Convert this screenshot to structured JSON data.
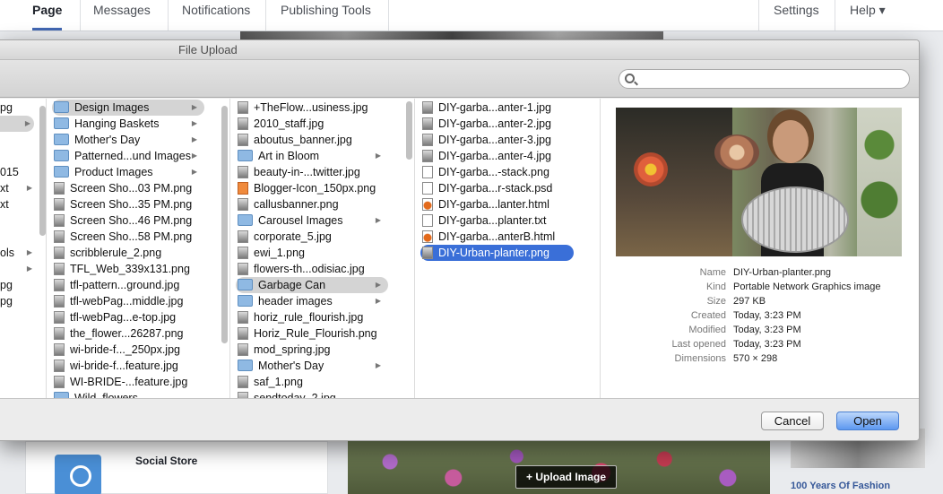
{
  "fb": {
    "tabs": [
      "Page",
      "Messages",
      "Notifications",
      "Publishing Tools",
      "Settings",
      "Help ▾"
    ],
    "left_card_label": "Social Store",
    "upload_button": "+ Upload Image",
    "right_caption": "100 Years Of Fashion"
  },
  "dialog": {
    "title": "File Upload",
    "search_placeholder": "",
    "col0": [
      "pg",
      "",
      "",
      "",
      "015",
      "xt",
      "xt",
      "",
      "",
      "ols",
      "",
      "pg",
      "pg"
    ],
    "col1": [
      {
        "label": "Design Images",
        "type": "folder",
        "selected": "grey",
        "chev": true
      },
      {
        "label": "Hanging Baskets",
        "type": "folder",
        "chev": true
      },
      {
        "label": "Mother's Day",
        "type": "folder",
        "chev": true
      },
      {
        "label": "Patterned...und Images",
        "type": "folder",
        "chev": true
      },
      {
        "label": "Product Images",
        "type": "folder",
        "chev": true
      },
      {
        "label": "Screen Sho...03 PM.png",
        "type": "img"
      },
      {
        "label": "Screen Sho...35 PM.png",
        "type": "img"
      },
      {
        "label": "Screen Sho...46 PM.png",
        "type": "img"
      },
      {
        "label": "Screen Sho...58 PM.png",
        "type": "img"
      },
      {
        "label": "scribblerule_2.png",
        "type": "img"
      },
      {
        "label": "TFL_Web_339x131.png",
        "type": "img"
      },
      {
        "label": "tfl-pattern...ground.jpg",
        "type": "img"
      },
      {
        "label": "tfl-webPag...middle.jpg",
        "type": "img"
      },
      {
        "label": "tfl-webPag...e-top.jpg",
        "type": "img"
      },
      {
        "label": "the_flower...26287.png",
        "type": "img"
      },
      {
        "label": "wi-bride-f..._250px.jpg",
        "type": "img"
      },
      {
        "label": "wi-bride-f...feature.jpg",
        "type": "img"
      },
      {
        "label": "WI-BRIDE-...feature.jpg",
        "type": "img"
      },
      {
        "label": "Wild_flowers",
        "type": "folder"
      }
    ],
    "col2": [
      {
        "label": "+TheFlow...usiness.jpg",
        "type": "img"
      },
      {
        "label": "2010_staff.jpg",
        "type": "img"
      },
      {
        "label": "aboutus_banner.jpg",
        "type": "img"
      },
      {
        "label": "Art in Bloom",
        "type": "folder",
        "chev": true
      },
      {
        "label": "beauty-in-...twitter.jpg",
        "type": "img"
      },
      {
        "label": "Blogger-Icon_150px.png",
        "type": "orange"
      },
      {
        "label": "callusbanner.png",
        "type": "img"
      },
      {
        "label": "Carousel Images",
        "type": "folder",
        "chev": true
      },
      {
        "label": "corporate_5.jpg",
        "type": "img"
      },
      {
        "label": "ewi_1.png",
        "type": "img"
      },
      {
        "label": "flowers-th...odisiac.jpg",
        "type": "img"
      },
      {
        "label": "Garbage Can",
        "type": "folder",
        "selected": "grey",
        "chev": true
      },
      {
        "label": "header images",
        "type": "folder",
        "chev": true
      },
      {
        "label": "horiz_rule_flourish.jpg",
        "type": "img"
      },
      {
        "label": "Horiz_Rule_Flourish.png",
        "type": "img"
      },
      {
        "label": "mod_spring.jpg",
        "type": "img"
      },
      {
        "label": "Mother's Day",
        "type": "folder",
        "chev": true
      },
      {
        "label": "saf_1.png",
        "type": "img"
      },
      {
        "label": "sendtoday_2.jpg",
        "type": "img"
      }
    ],
    "col3": [
      {
        "label": "DIY-garba...anter-1.jpg",
        "type": "img"
      },
      {
        "label": "DIY-garba...anter-2.jpg",
        "type": "img"
      },
      {
        "label": "DIY-garba...anter-3.jpg",
        "type": "img"
      },
      {
        "label": "DIY-garba...anter-4.jpg",
        "type": "img"
      },
      {
        "label": "DIY-garba...-stack.png",
        "type": "file"
      },
      {
        "label": "DIY-garba...r-stack.psd",
        "type": "file"
      },
      {
        "label": "DIY-garba...lanter.html",
        "type": "html"
      },
      {
        "label": "DIY-garba...planter.txt",
        "type": "file"
      },
      {
        "label": "DIY-garba...anterB.html",
        "type": "html"
      },
      {
        "label": "DIY-Urban-planter.png",
        "type": "img",
        "selected": "blue"
      }
    ],
    "info": [
      {
        "k": "Name",
        "v": "DIY-Urban-planter.png"
      },
      {
        "k": "Kind",
        "v": "Portable Network Graphics image"
      },
      {
        "k": "Size",
        "v": "297 KB"
      },
      {
        "k": "Created",
        "v": "Today, 3:23 PM"
      },
      {
        "k": "Modified",
        "v": "Today, 3:23 PM"
      },
      {
        "k": "Last opened",
        "v": "Today, 3:23 PM"
      },
      {
        "k": "Dimensions",
        "v": "570 × 298"
      }
    ],
    "cancel_label": "Cancel",
    "open_label": "Open"
  }
}
